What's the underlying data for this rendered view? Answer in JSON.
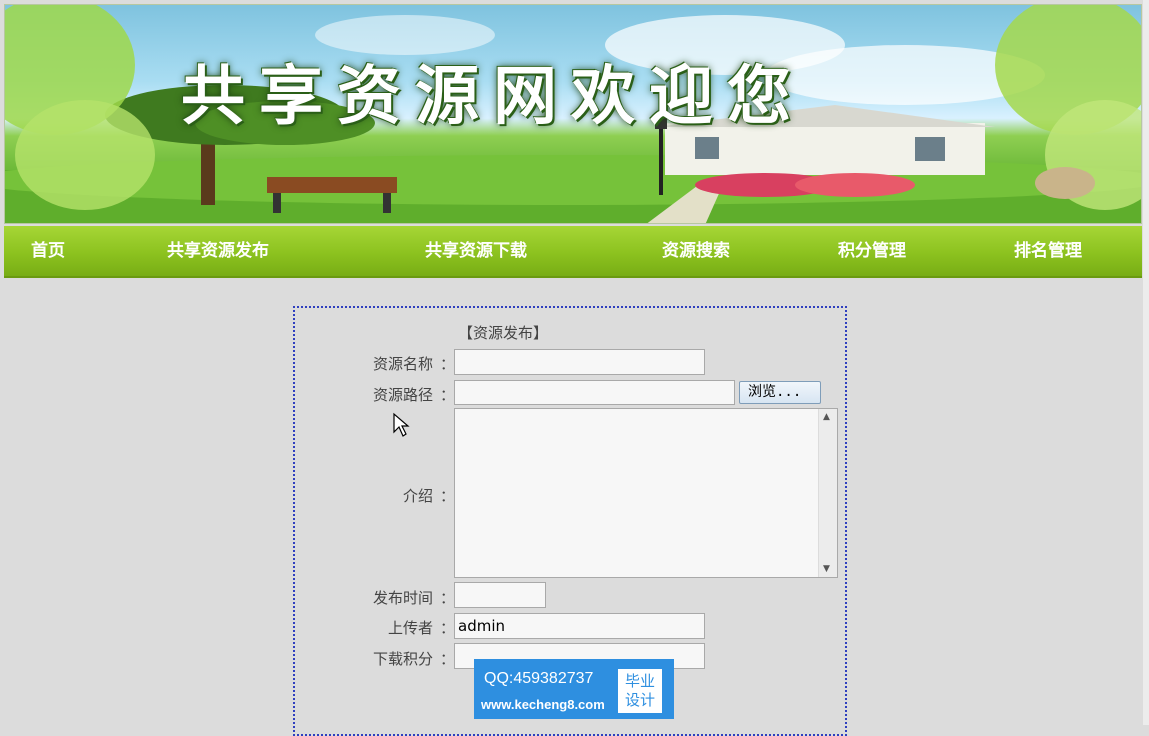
{
  "banner": {
    "title": "共享资源网欢迎您"
  },
  "nav": {
    "items": [
      {
        "label": "首页"
      },
      {
        "label": "共享资源发布"
      },
      {
        "label": "共享资源下载"
      },
      {
        "label": "资源搜索"
      },
      {
        "label": "积分管理"
      },
      {
        "label": "排名管理"
      }
    ]
  },
  "form": {
    "title": "【资源发布】",
    "colon": "：",
    "fields": {
      "name": {
        "label": "资源名称",
        "value": ""
      },
      "path": {
        "label": "资源路径",
        "value": "",
        "browse_label": "浏览..."
      },
      "intro": {
        "label": "介绍",
        "value": ""
      },
      "publish_time": {
        "label": "发布时间",
        "value": ""
      },
      "uploader": {
        "label": "上传者",
        "value": "admin"
      },
      "download_points": {
        "label": "下载积分",
        "value": ""
      }
    }
  },
  "watermark": {
    "qq": "QQ:459382737",
    "url": "www.kecheng8.com",
    "badge_line1": "毕业",
    "badge_line2": "设计"
  },
  "colors": {
    "nav_bg": "#8cc21f",
    "page_bg": "#dcdcdc",
    "form_border": "#2f3fbf",
    "watermark_bg": "#2e8fe0"
  }
}
